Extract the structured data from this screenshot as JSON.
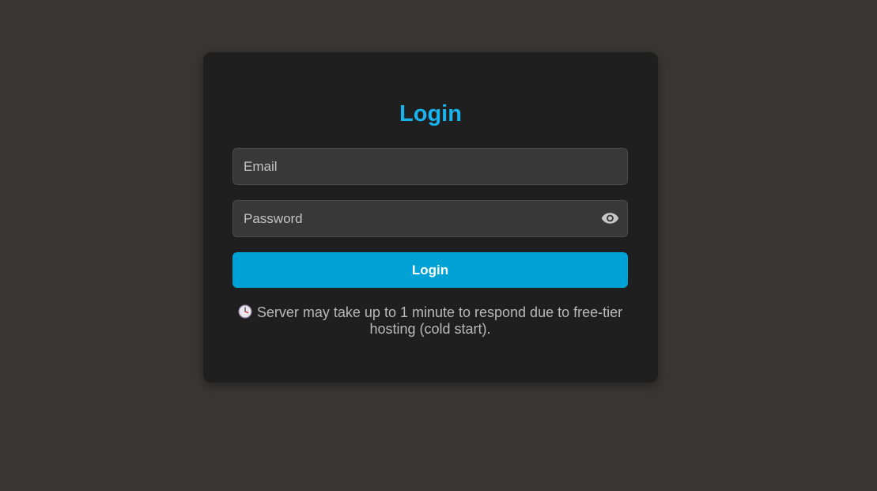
{
  "login": {
    "title": "Login",
    "email_placeholder": "Email",
    "password_placeholder": "Password",
    "submit_label": "Login",
    "notice_icon": "clock-icon",
    "notice_text": "Server may take up to 1 minute to respond due to free-tier hosting (cold start).",
    "password_toggle_icon": "eye-icon"
  },
  "colors": {
    "page_background": "#383735",
    "card_background": "#1f1f1f",
    "title_accent": "#1ab2ee",
    "button_background": "#00a2d5",
    "input_background": "#383838"
  }
}
